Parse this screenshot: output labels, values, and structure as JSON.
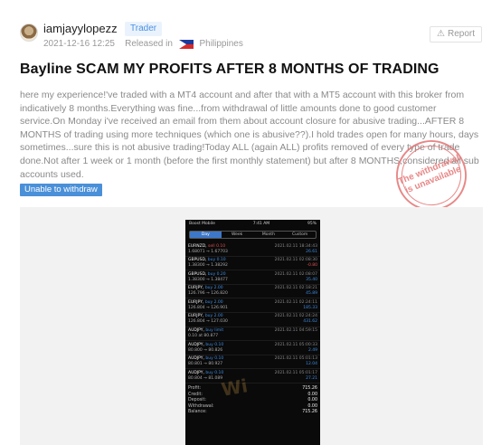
{
  "author": {
    "name": "iamjayylopezz",
    "role": "Trader",
    "date": "2021-12-16 12:25",
    "released_in_label": "Released in",
    "country": "Philippines"
  },
  "report_label": "Report",
  "post": {
    "title": "Bayline SCAM MY PROFITS AFTER 8 MONTHS OF TRADING",
    "body": "here my experience!'ve traded with a MT4 account and after that with a MT5 account with this broker from indicatively 8 months.Everything was fine...from withdrawal of little amounts done to good customer service.On Monday i've received an email from them about account closure for abusive trading...AFTER 8 MONTHS of trading using more techniques (which one is abusive??).I hold trades open for many hours, days sometimes...sure this is not abusive trading!Today ALL (again ALL) profits removed of every type of trade done.Not after 1 week or 1 month (before the first monthly statement) but after 8 MONTHS,considered all sub accounts used.",
    "tag": "Unable to withdraw",
    "stamp_line1": "The withdrawal",
    "stamp_line2": "is unavailable"
  },
  "phone": {
    "carrier": "Boost Mobile",
    "time": "7:41 AM",
    "battery": "95%",
    "tabs": [
      "Day",
      "Week",
      "Month",
      "Custom"
    ],
    "active_tab": "Day",
    "trades": [
      {
        "symbol": "EURNZD,",
        "dir": "sell 0.10",
        "side": "sell",
        "time": "2021.02.11 18:34:43",
        "prices": "1.68071 → 1.67703",
        "pl": "26.61"
      },
      {
        "symbol": "GBPUSD,",
        "dir": "buy 0.10",
        "side": "buy",
        "time": "2021.02.11 02:08:30",
        "prices": "1.38300 → 1.38292",
        "pl": "-0.80"
      },
      {
        "symbol": "GBPUSD,",
        "dir": "buy 0.20",
        "side": "buy",
        "time": "2021.02.11 02:08:07",
        "prices": "1.38300 → 1.38477",
        "pl": "35.40"
      },
      {
        "symbol": "EURJPY,",
        "dir": "buy 2.00",
        "side": "buy",
        "time": "2021.02.11 02:18:21",
        "prices": "126.796 → 126.820",
        "pl": "45.89"
      },
      {
        "symbol": "EURJPY,",
        "dir": "buy 2.00",
        "side": "buy",
        "time": "2021.02.11 02:24:11",
        "prices": "126.804 → 126.901",
        "pl": "185.33"
      },
      {
        "symbol": "EURJPY,",
        "dir": "buy 2.00",
        "side": "buy",
        "time": "2021.02.11 02:24:24",
        "prices": "126.804 → 127.030",
        "pl": "431.62"
      },
      {
        "symbol": "AUDJPY,",
        "dir": "buy limit",
        "side": "buy",
        "time": "2021.02.11 04:59:15",
        "prices": "0.10 at 80.877",
        "pl": ""
      },
      {
        "symbol": "AUDJPY,",
        "dir": "buy 0.10",
        "side": "buy",
        "time": "2021.02.11 05:00:33",
        "prices": "80.800 → 80.826",
        "pl": "2.49"
      },
      {
        "symbol": "AUDJPY,",
        "dir": "buy 0.10",
        "side": "buy",
        "time": "2021.02.11 05:01:13",
        "prices": "80.801 → 80.927",
        "pl": "12.04"
      },
      {
        "symbol": "AUDJPY,",
        "dir": "buy 0.10",
        "side": "buy",
        "time": "2021.02.11 05:01:17",
        "prices": "80.804 → 81.089",
        "pl": "27.21"
      }
    ],
    "summary": [
      {
        "label": "Profit:",
        "value": "715.26"
      },
      {
        "label": "Credit:",
        "value": "0.00"
      },
      {
        "label": "Deposit:",
        "value": "0.00"
      },
      {
        "label": "Withdrawal:",
        "value": "0.00"
      },
      {
        "label": "Balance:",
        "value": "715.26"
      }
    ]
  }
}
